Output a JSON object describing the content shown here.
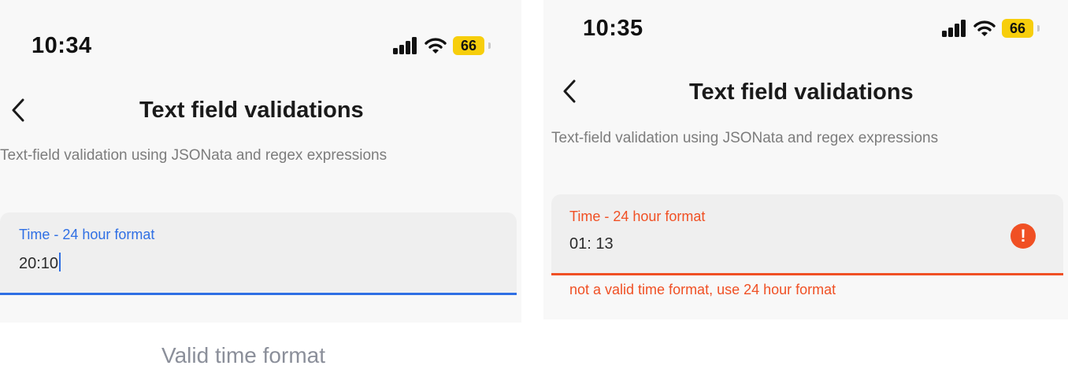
{
  "colors": {
    "accent_blue": "#2f6fe4",
    "error_red": "#f05024",
    "battery_yellow": "#f7ce0c",
    "screen_bg": "#f8f8f8",
    "field_bg": "#efefef"
  },
  "left_screen": {
    "status_bar": {
      "time": "10:34",
      "battery": "66",
      "icons": [
        "signal-icon",
        "wifi-icon",
        "battery-icon"
      ]
    },
    "header": {
      "back_icon": "chevron-left-icon",
      "title": "Text field validations"
    },
    "description": "Text-field validation using JSONata and regex expressions",
    "field": {
      "label": "Time - 24 hour format",
      "value": "20:10",
      "state": "focused"
    }
  },
  "right_screen": {
    "status_bar": {
      "time": "10:35",
      "battery": "66",
      "icons": [
        "signal-icon",
        "wifi-icon",
        "battery-icon"
      ]
    },
    "header": {
      "back_icon": "chevron-left-icon",
      "title": "Text field validations"
    },
    "description": "Text-field validation using JSONata and regex expressions",
    "field": {
      "label": "Time - 24 hour format",
      "value": "01: 13",
      "state": "error",
      "error_icon": "exclamation-icon",
      "error_icon_glyph": "!",
      "error_message": "not a valid time format, use 24 hour format"
    }
  },
  "caption": "Valid time format"
}
